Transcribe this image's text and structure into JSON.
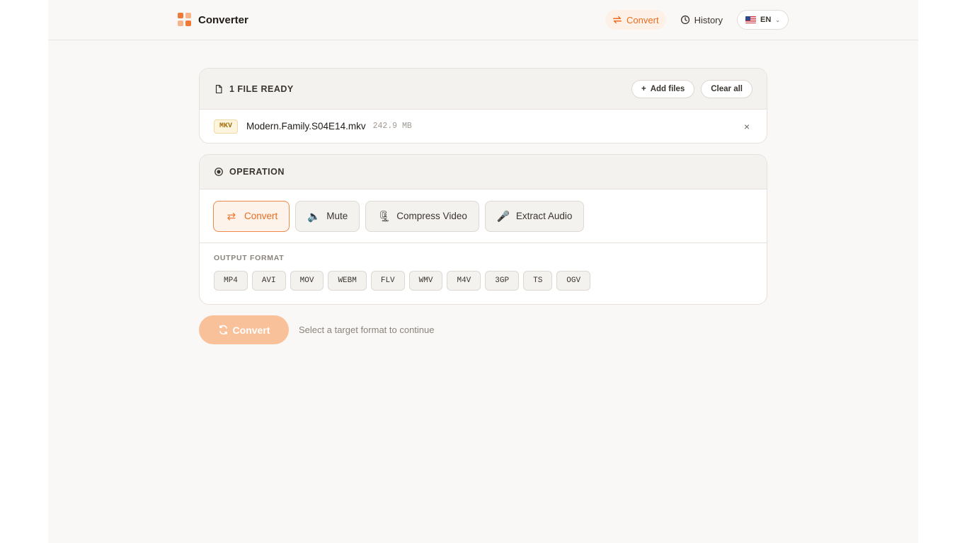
{
  "app": {
    "name": "Converter"
  },
  "nav": {
    "items": [
      {
        "label": "Convert",
        "icon": "convert-icon",
        "active": true
      },
      {
        "label": "History",
        "icon": "clock-icon",
        "active": false
      }
    ],
    "language": {
      "label": "EN",
      "flag": "us-flag-icon"
    }
  },
  "files": {
    "title": "1 FILE READY",
    "add_label": "Add files",
    "clear_label": "Clear all",
    "items": [
      {
        "ext": "MKV",
        "name": "Modern.Family.S04E14.mkv",
        "size": "242.9 MB"
      }
    ]
  },
  "operation": {
    "title": "OPERATION",
    "options": [
      {
        "label": "Convert",
        "icon": "⇄",
        "active": true
      },
      {
        "label": "Mute",
        "icon": "🔈",
        "active": false
      },
      {
        "label": "Compress Video",
        "icon": "🗜",
        "active": false
      },
      {
        "label": "Extract Audio",
        "icon": "🎤",
        "active": false
      }
    ]
  },
  "output": {
    "label": "OUTPUT FORMAT",
    "formats": [
      "MP4",
      "AVI",
      "MOV",
      "WEBM",
      "FLV",
      "WMV",
      "M4V",
      "3GP",
      "TS",
      "OGV"
    ]
  },
  "action": {
    "button_label": "Convert",
    "hint": "Select a target format to continue"
  },
  "colors": {
    "accent": "#ea6c1f",
    "accent_light": "#f9c19a"
  }
}
